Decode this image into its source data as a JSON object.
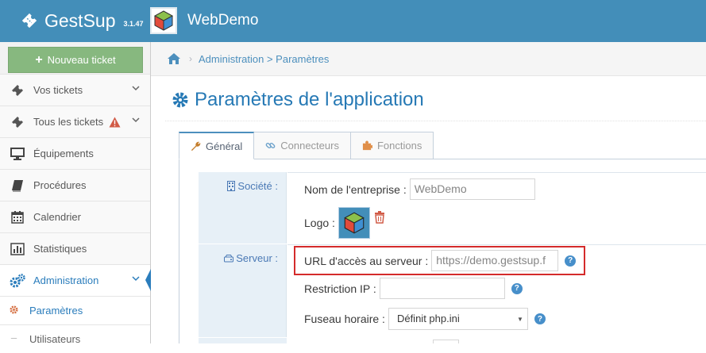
{
  "header": {
    "brand_name": "GestSup",
    "version": "3.1.47",
    "company_name": "WebDemo"
  },
  "sidebar": {
    "new_ticket_label": "Nouveau ticket",
    "items": [
      {
        "label": "Vos tickets",
        "icon": "ticket-icon"
      },
      {
        "label": "Tous les tickets",
        "icon": "ticket-icon"
      },
      {
        "label": "Équipements",
        "icon": "desktop-icon"
      },
      {
        "label": "Procédures",
        "icon": "book-icon"
      },
      {
        "label": "Calendrier",
        "icon": "calendar-icon"
      },
      {
        "label": "Statistiques",
        "icon": "bar-chart-icon"
      },
      {
        "label": "Administration",
        "icon": "cogs-icon"
      }
    ],
    "subitems": [
      {
        "label": "Paramètres"
      },
      {
        "label": "Utilisateurs"
      }
    ]
  },
  "breadcrumb": {
    "path": "Administration > Paramètres"
  },
  "page": {
    "title": "Paramètres de l'application"
  },
  "tabs": [
    {
      "label": "Général",
      "icon": "wrench-icon"
    },
    {
      "label": "Connecteurs",
      "icon": "link-icon"
    },
    {
      "label": "Fonctions",
      "icon": "puzzle-icon"
    }
  ],
  "sections": {
    "societe": {
      "label": "Société :",
      "company_label": "Nom de l'entreprise :",
      "company_value": "WebDemo",
      "logo_label": "Logo :"
    },
    "serveur": {
      "label": "Serveur :",
      "url_label": "URL d'accès au serveur :",
      "url_value": "https://demo.gestsup.f",
      "ip_label": "Restriction IP :",
      "ip_value": "",
      "timezone_label": "Fuseau horaire :",
      "timezone_value": "Définit php.ini"
    }
  },
  "colors": {
    "navbar": "#438eb9",
    "accent": "#2679b5",
    "new_ticket": "#87b87f",
    "warning": "#d15b47",
    "highlight": "#d42b2b"
  }
}
